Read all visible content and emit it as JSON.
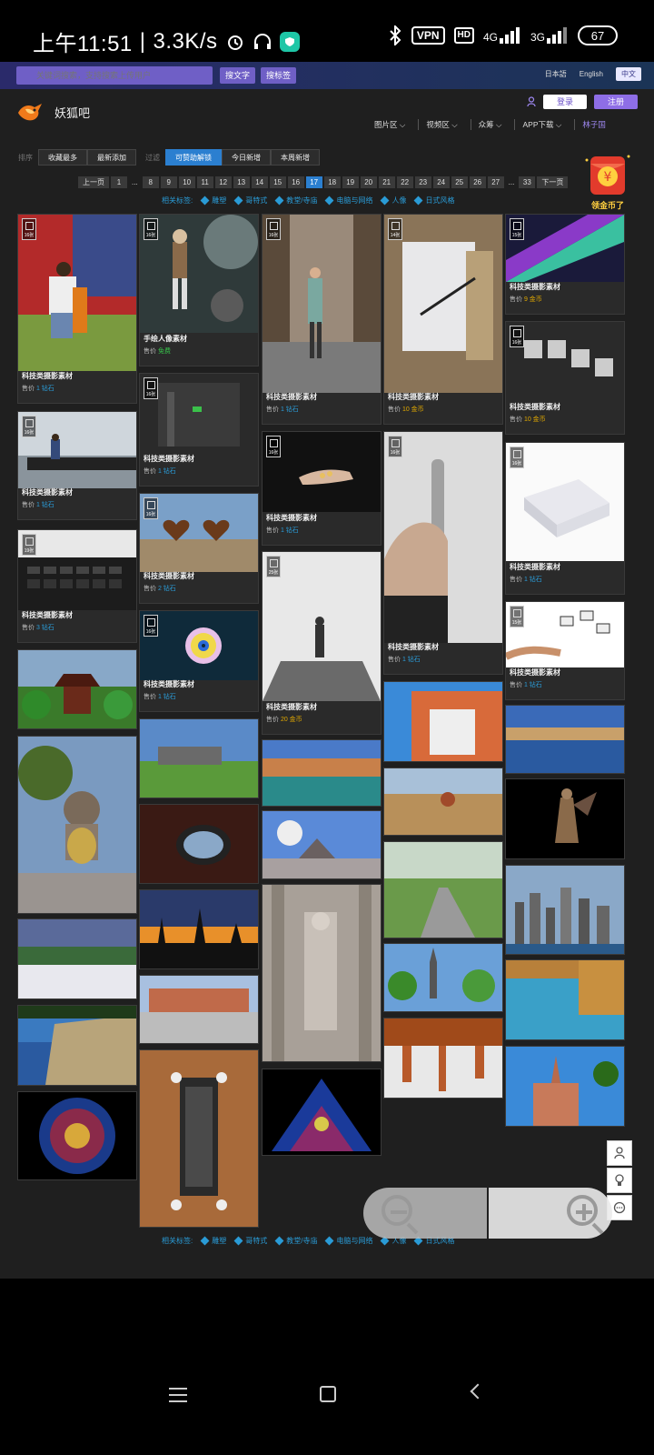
{
  "status": {
    "time": "上午11:51",
    "speed": "3.3K/s",
    "vpn": "VPN",
    "hd": "HD",
    "net1": "4G",
    "net2": "3G",
    "battery": "67"
  },
  "search": {
    "placeholder": "关键词搜索，支持搜索上传用户",
    "btn_text": "搜文字",
    "btn_tag": "搜标签"
  },
  "langs": [
    "日本語",
    "English",
    "中文"
  ],
  "header": {
    "brand": "妖狐吧",
    "login": "登录",
    "register": "注册",
    "nav": [
      "图片区",
      "视频区",
      "众筹",
      "APP下载",
      "林子国"
    ]
  },
  "filter": {
    "sort_label": "排序",
    "sort_tabs": [
      "收藏最多",
      "最新添加"
    ],
    "filter_label": "过滤",
    "filter_tabs": [
      "可赞助解锁",
      "今日新增",
      "本周新增"
    ]
  },
  "pager": {
    "prev": "上一页",
    "next": "下一页",
    "pages": [
      "1",
      "...",
      "8",
      "9",
      "10",
      "11",
      "12",
      "13",
      "14",
      "15",
      "16",
      "17",
      "18",
      "19",
      "20",
      "21",
      "22",
      "23",
      "24",
      "25",
      "26",
      "27",
      "...",
      "33"
    ],
    "current": "17"
  },
  "tags": {
    "label": "相关标签:",
    "items": [
      "雕塑",
      "哥特式",
      "教堂/寺庙",
      "电脑与网络",
      "人像",
      "日式风格"
    ]
  },
  "coin": {
    "text": "领金币了"
  },
  "cards": {
    "c1": {
      "title": "科技类摄影素材",
      "price_label": "售价",
      "price": "1 钻石",
      "count": "16张"
    },
    "c2": {
      "title": "科技类摄影素材",
      "price_label": "售价",
      "price": "1 钻石",
      "count": "16张"
    },
    "c3": {
      "title": "科技类摄影素材",
      "price_label": "售价",
      "price": "3 钻石",
      "count": "19张"
    },
    "c4": {
      "title": "手绘人像素材",
      "price_label": "售价",
      "price": "免费",
      "count": "16张"
    },
    "c5": {
      "title": "科技类摄影素材",
      "price_label": "售价",
      "price": "1 钻石",
      "count": "16张"
    },
    "c6": {
      "title": "科技类摄影素材",
      "price_label": "售价",
      "price": "2 钻石",
      "count": "16张"
    },
    "c7": {
      "title": "科技类摄影素材",
      "price_label": "售价",
      "price": "1 钻石",
      "count": "16张"
    },
    "c8": {
      "title": "科技类摄影素材",
      "price_label": "售价",
      "price": "1 钻石",
      "count": "16张"
    },
    "c9": {
      "title": "科技类摄影素材",
      "price_label": "售价",
      "price": "1 钻石",
      "count": "16张"
    },
    "c10": {
      "title": "科技类摄影素材",
      "price_label": "售价",
      "price": "20 金币",
      "count": "25张"
    },
    "c11": {
      "title": "科技类摄影素材",
      "price_label": "售价",
      "price": "10 金币",
      "count": "14张"
    },
    "c12": {
      "title": "科技类摄影素材",
      "price_label": "售价",
      "price": "1 钻石",
      "count": "16张"
    },
    "c13": {
      "title": "科技类摄影素材",
      "price_label": "售价",
      "price": "9 金币",
      "count": "15张"
    },
    "c14": {
      "title": "科技类摄影素材",
      "price_label": "售价",
      "price": "10 金币",
      "count": "16张"
    },
    "c15": {
      "title": "科技类摄影素材",
      "price_label": "售价",
      "price": "1 钻石",
      "count": "16张"
    },
    "c16": {
      "title": "科技类摄影素材",
      "price_label": "售价",
      "price": "1 钻石",
      "count": "15张"
    }
  },
  "colors": {
    "accent": "#2b7fd0",
    "purple": "#8e6ee6",
    "link": "#2a9bd6",
    "gold": "#e0a800",
    "free": "#37c44b"
  }
}
